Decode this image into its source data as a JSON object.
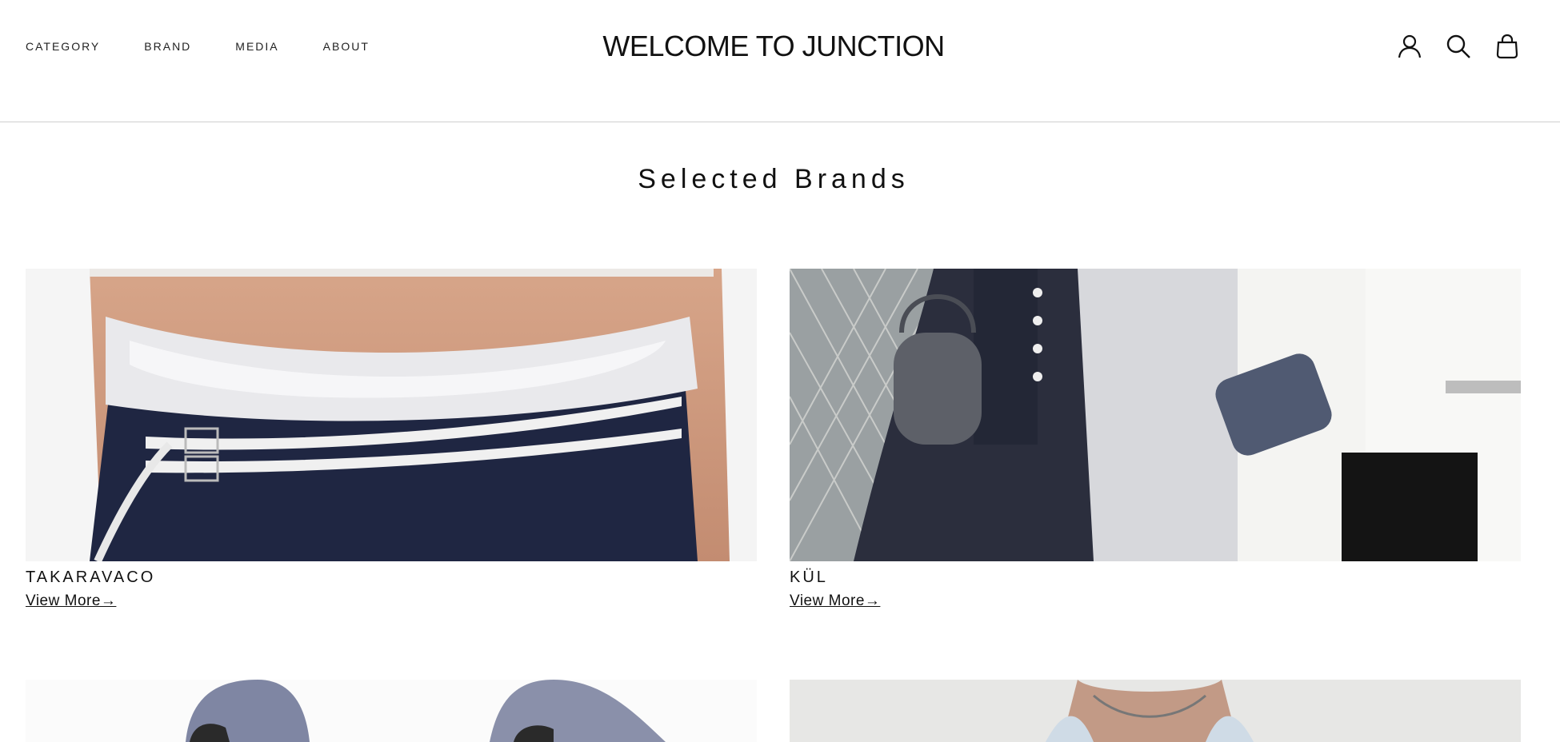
{
  "header": {
    "nav": [
      "CATEGORY",
      "BRAND",
      "MEDIA",
      "ABOUT"
    ],
    "logo": "WELCOME TO JUNCTION",
    "icons": [
      "account-icon",
      "search-icon",
      "cart-icon"
    ]
  },
  "main": {
    "title": "Selected Brands",
    "brands": [
      {
        "name": "TAKARAVACO",
        "link": "View More→"
      },
      {
        "name": "KÜL",
        "link": "View More→"
      }
    ]
  }
}
